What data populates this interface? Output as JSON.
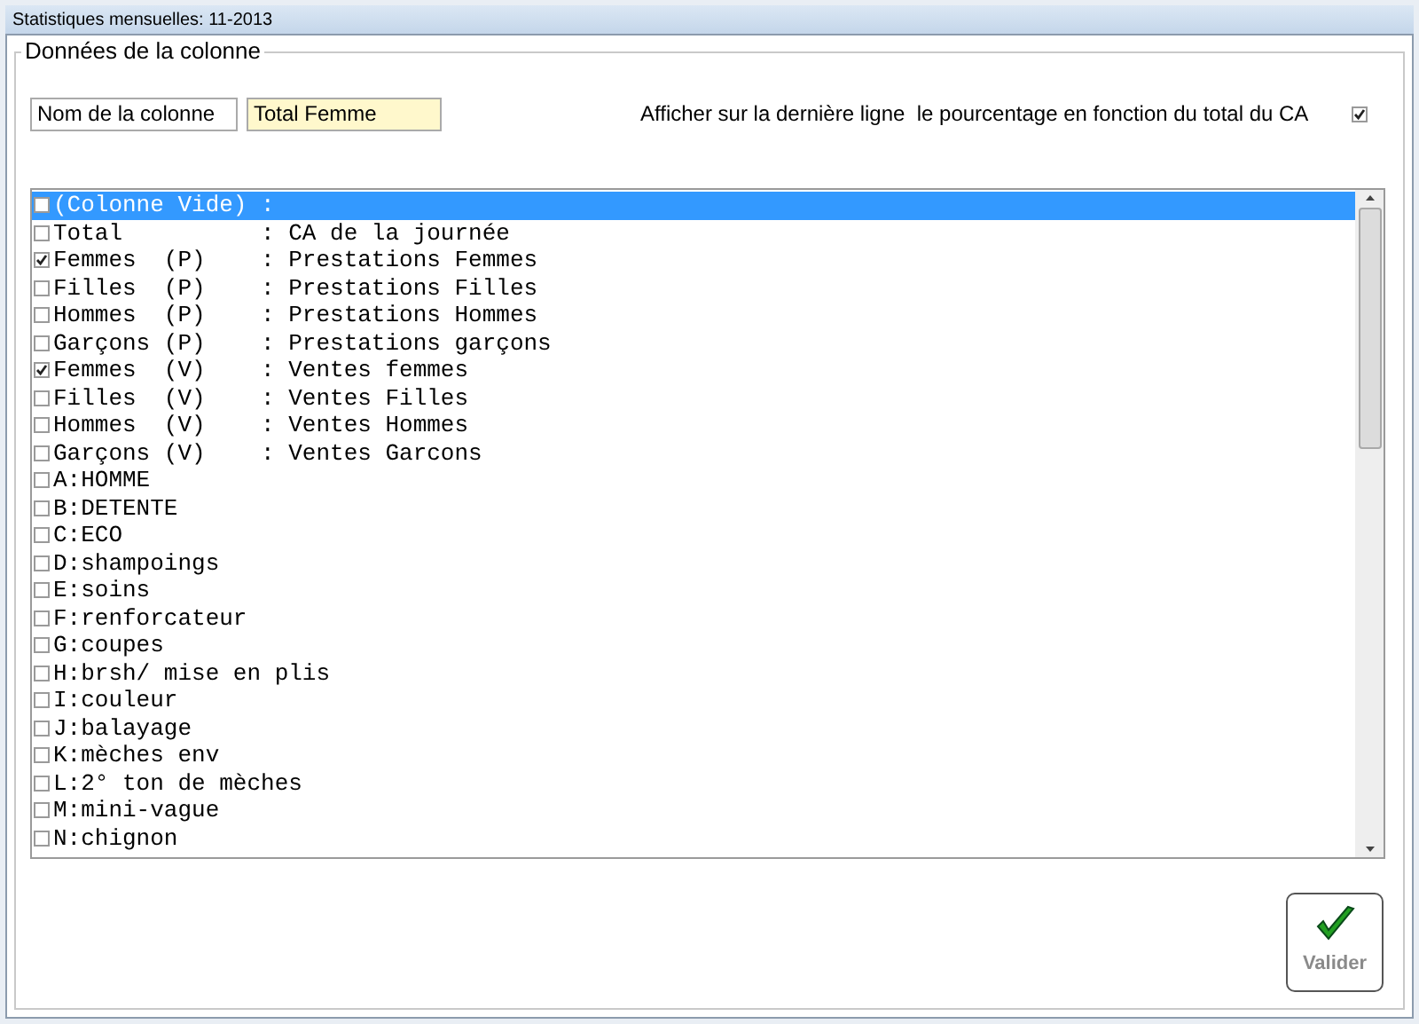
{
  "window": {
    "title": "Statistiques mensuelles: 11-2013"
  },
  "group": {
    "legend": "Données de la colonne"
  },
  "column_name": {
    "label": "Nom de la colonne",
    "value": "Total Femme"
  },
  "percent_option": {
    "label": "Afficher sur la dernière ligne  le pourcentage en fonction du total du CA",
    "checked": true
  },
  "items": [
    {
      "text": "(Colonne Vide) :",
      "checked": false,
      "selected": true
    },
    {
      "text": "Total          : CA de la journée",
      "checked": false,
      "selected": false
    },
    {
      "text": "Femmes  (P)    : Prestations Femmes",
      "checked": true,
      "selected": false
    },
    {
      "text": "Filles  (P)    : Prestations Filles",
      "checked": false,
      "selected": false
    },
    {
      "text": "Hommes  (P)    : Prestations Hommes",
      "checked": false,
      "selected": false
    },
    {
      "text": "Garçons (P)    : Prestations garçons",
      "checked": false,
      "selected": false
    },
    {
      "text": "Femmes  (V)    : Ventes femmes",
      "checked": true,
      "selected": false
    },
    {
      "text": "Filles  (V)    : Ventes Filles",
      "checked": false,
      "selected": false
    },
    {
      "text": "Hommes  (V)    : Ventes Hommes",
      "checked": false,
      "selected": false
    },
    {
      "text": "Garçons (V)    : Ventes Garcons",
      "checked": false,
      "selected": false
    },
    {
      "text": "A:HOMME",
      "checked": false,
      "selected": false
    },
    {
      "text": "B:DETENTE",
      "checked": false,
      "selected": false
    },
    {
      "text": "C:ECO",
      "checked": false,
      "selected": false
    },
    {
      "text": "D:shampoings",
      "checked": false,
      "selected": false
    },
    {
      "text": "E:soins",
      "checked": false,
      "selected": false
    },
    {
      "text": "F:renforcateur",
      "checked": false,
      "selected": false
    },
    {
      "text": "G:coupes",
      "checked": false,
      "selected": false
    },
    {
      "text": "H:brsh/ mise en plis",
      "checked": false,
      "selected": false
    },
    {
      "text": "I:couleur",
      "checked": false,
      "selected": false
    },
    {
      "text": "J:balayage",
      "checked": false,
      "selected": false
    },
    {
      "text": "K:mèches env",
      "checked": false,
      "selected": false
    },
    {
      "text": "L:2° ton de mèches",
      "checked": false,
      "selected": false
    },
    {
      "text": "M:mini-vague",
      "checked": false,
      "selected": false
    },
    {
      "text": "N:chignon",
      "checked": false,
      "selected": false
    }
  ],
  "validate_button": {
    "label": "Valider"
  }
}
